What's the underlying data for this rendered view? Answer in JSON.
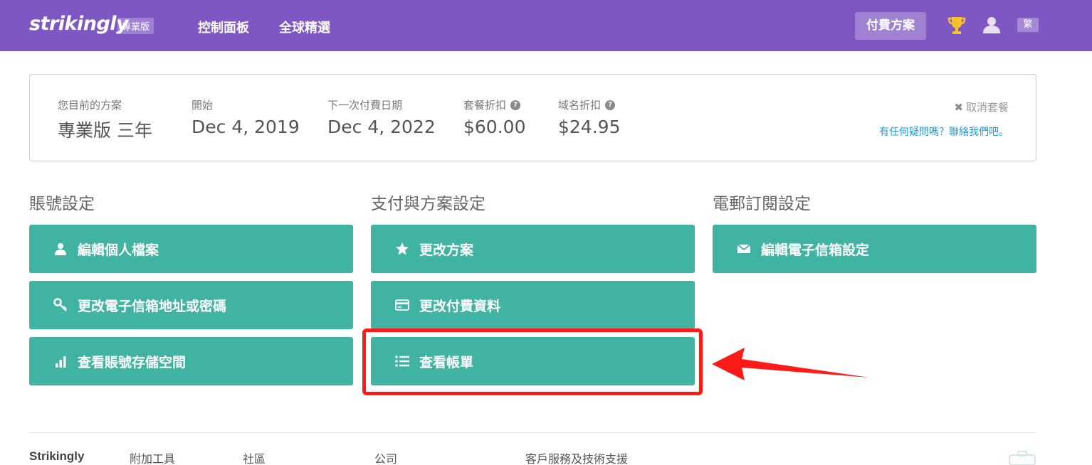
{
  "header": {
    "logo": "strikingly",
    "plan_badge": "專業版",
    "nav": [
      "控制面板",
      "全球精選"
    ],
    "upgrade_label": "付費方案",
    "lang_label": "繁"
  },
  "plan": {
    "current_plan_label": "您目前的方案",
    "current_plan_value": "專業版 三年",
    "start_label": "開始",
    "start_value": "Dec 4, 2019",
    "next_payment_label": "下一次付費日期",
    "next_payment_value": "Dec 4, 2022",
    "plan_discount_label": "套餐折扣",
    "plan_discount_value": "$60.00",
    "domain_discount_label": "域名折扣",
    "domain_discount_value": "$24.95",
    "cancel_label": "取消套餐",
    "contact_label": "有任何疑問嗎？聯絡我們吧。"
  },
  "sections": {
    "account": {
      "title": "賬號設定",
      "buttons": [
        "編輯個人檔案",
        "更改電子信箱地址或密碼",
        "查看賬號存儲空間"
      ]
    },
    "payment": {
      "title": "支付與方案設定",
      "buttons": [
        "更改方案",
        "更改付費資料",
        "查看帳單"
      ]
    },
    "email": {
      "title": "電郵訂閱設定",
      "buttons": [
        "編輯電子信箱設定"
      ]
    }
  },
  "footer": {
    "brand": "Strikingly",
    "columns": [
      "附加工具",
      "社區",
      "公司",
      "客戶服務及技術支援"
    ]
  },
  "colors": {
    "topbar": "#7e57c2",
    "button": "#41b3a3",
    "highlight": "#ff1a1a",
    "link": "#1e9bd7"
  },
  "icons": [
    "trophy-icon",
    "user-icon",
    "help-icon",
    "close-icon",
    "person-icon",
    "key-icon",
    "bar-chart-icon",
    "star-icon",
    "credit-card-icon",
    "list-icon",
    "envelope-icon",
    "arrow-annotation",
    "robot-mascot-icon"
  ]
}
